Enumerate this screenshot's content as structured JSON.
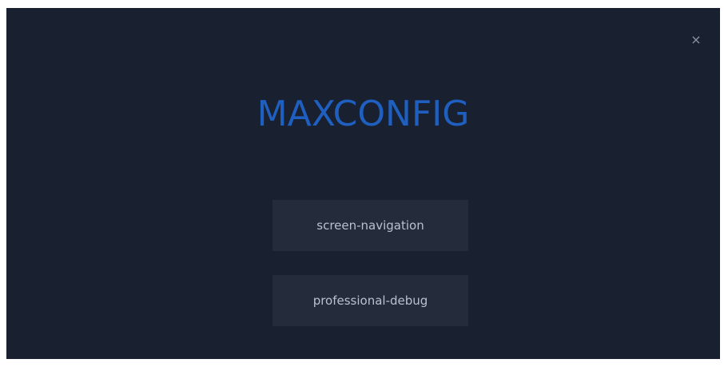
{
  "dialog": {
    "close_glyph": "×",
    "logo_text": "MAXCONFIG",
    "buttons": [
      {
        "label": "screen-navigation"
      },
      {
        "label": "professional-debug"
      }
    ]
  },
  "colors": {
    "background": "#19202f",
    "logo": "#1e5fbf",
    "button_bg": "#242c3b",
    "button_text": "#b9c1cf",
    "close_icon": "#8c93a2"
  },
  "icons": {
    "close": "close-icon"
  }
}
